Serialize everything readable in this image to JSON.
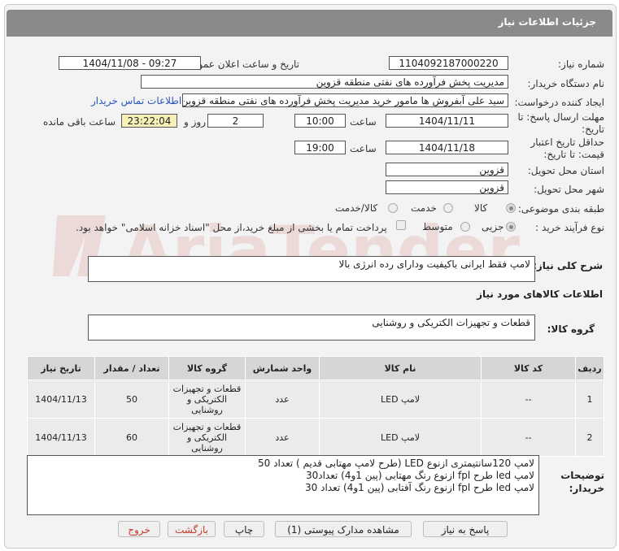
{
  "header": {
    "title": "جزئیات اطلاعات نیاز"
  },
  "form": {
    "need_number_label": "شماره نیاز:",
    "need_number": "1104092187000220",
    "announce_label": "تاریخ و ساعت اعلان عمومی:",
    "announce_value": "1404/11/08 - 09:27",
    "buyer_org_label": "نام دستگاه خریدار:",
    "buyer_org": "مدیریت پخش فرآورده های نفتی منطقه قزوین",
    "requester_label": "ایجاد کننده درخواست:",
    "requester": "سید علی  آبفروش ها مامور خرید مدیریت پخش فرآورده های نفتی منطقه قزوین",
    "contact_link": "اطلاعات تماس خریدار",
    "deadline_label": "مهلت ارسال پاسخ: تا تاریخ:",
    "deadline_date": "1404/11/11",
    "time_label": "ساعت",
    "deadline_time": "10:00",
    "days_value": "2",
    "days_label": "روز و",
    "remaining_time": "23:22:04",
    "remaining_label": "ساعت باقی مانده",
    "validity_label": "حداقل تاریخ اعتبار قیمت: تا تاریخ:",
    "validity_date": "1404/11/18",
    "validity_time": "19:00",
    "province_label": "استان محل تحویل:",
    "province": "قزوین",
    "city_label": "شهر محل تحویل:",
    "city": "قزوین",
    "category_label": "طبقه بندی موضوعی:",
    "category_options": [
      "کالا",
      "خدمت",
      "کالا/خدمت"
    ],
    "purchase_type_label": "نوع فرآیند خرید :",
    "purchase_type_options": [
      "جزیی",
      "متوسط"
    ],
    "payment_note": "پرداخت تمام یا بخشی از مبلغ خرید،از محل \"اسناد خزانه اسلامی\" خواهد بود."
  },
  "summary": {
    "label": "شرح کلی نیاز:",
    "text": "لامپ  فقط ایرانی باکیفیت ودارای  رده انرژی بالا"
  },
  "goods_info": {
    "title": "اطلاعات کالاهای مورد نیاز",
    "group_label": "گروه کالا:",
    "group_value": "قطعات و تجهیزات الکتریکی و روشنایی"
  },
  "table": {
    "headers": [
      "ردیف",
      "کد کالا",
      "نام کالا",
      "واحد شمارش",
      "گروه کالا",
      "تعداد / مقدار",
      "تاریخ نیاز"
    ],
    "rows": [
      {
        "row": "1",
        "code": "--",
        "name": "لامپ LED",
        "unit": "عدد",
        "group": "قطعات و تجهیزات الکتریکی و روشنایی",
        "qty": "50",
        "date": "1404/11/13"
      },
      {
        "row": "2",
        "code": "--",
        "name": "لامپ LED",
        "unit": "عدد",
        "group": "قطعات و تجهیزات الکتریکی و روشنایی",
        "qty": "60",
        "date": "1404/11/13"
      }
    ]
  },
  "notes": {
    "label": "توضیحات خریدار:",
    "lines": [
      "لامپ 120سانتیمتری ازنوع LED (طرح لامپ مهتابی قدیم ) تعداد 50",
      "لامپ led طرح fpl  ازنوع رنگ مهتابی (پین 1و4) تعداد30",
      "لامپ led طرح fpl  ازنوع رنگ آفتابی  (پین 1و4) تعداد 30"
    ]
  },
  "buttons": {
    "reply": "پاسخ به نیاز",
    "view_docs": "مشاهده مدارک پیوستی (1)",
    "print": "چاپ",
    "back": "بازگشت",
    "exit": "خروج"
  },
  "watermark": {
    "text": "AriaTender.net"
  }
}
